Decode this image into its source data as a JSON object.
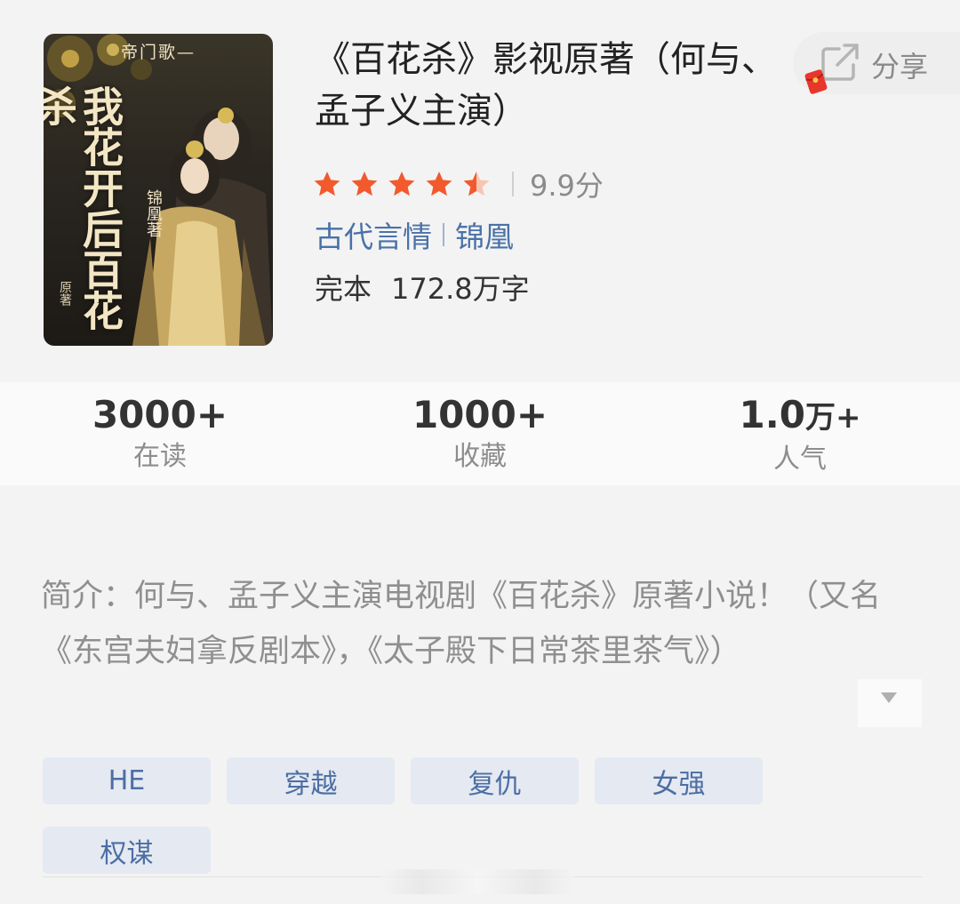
{
  "book": {
    "cover": {
      "series": "帝门歌—",
      "title_art": "我花开后百花杀",
      "author_art": "锦凰著",
      "note_art": "原著"
    },
    "title": "《百花杀》影视原著（何与、孟子义主演）",
    "rating": {
      "stars": 4.5,
      "score_text": "9.9分"
    },
    "category": "古代言情",
    "author": "锦凰",
    "status": "完本",
    "word_count": "172.8万字"
  },
  "share": {
    "label": "分享"
  },
  "stats": [
    {
      "value": "3000+",
      "label": "在读"
    },
    {
      "value": "1000+",
      "label": "收藏"
    },
    {
      "value": "1.0",
      "unit": "万+",
      "label": "人气"
    }
  ],
  "synopsis": {
    "text": "简介：何与、孟子义主演电视剧《百花杀》原著小说！（又名《东宫夫妇拿反剧本》，《太子殿下日常茶里茶气》）"
  },
  "tags": [
    "HE",
    "穿越",
    "复仇",
    "女强",
    "权谋"
  ],
  "colors": {
    "star": "#f25a2e",
    "link": "#4a72a8",
    "tag_bg": "#e4e9f2",
    "tag_text": "#4d6ea3"
  }
}
